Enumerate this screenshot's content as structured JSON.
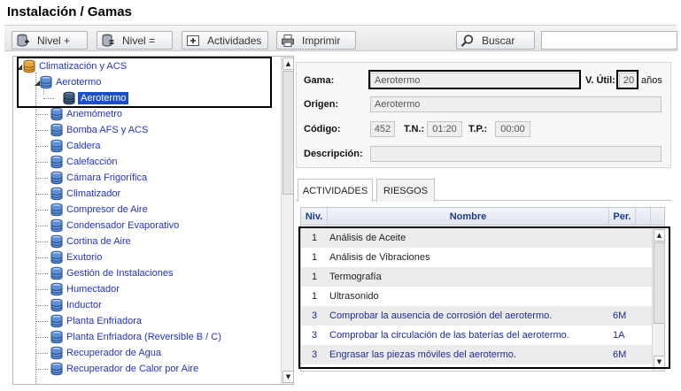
{
  "page": {
    "title": "Instalación / Gamas"
  },
  "toolbar": {
    "nivel_mas": "Nivel +",
    "nivel_igual": "Nivel =",
    "actividades": "Actividades",
    "imprimir": "Imprimir",
    "buscar": "Buscar",
    "search_value": ""
  },
  "tree": {
    "root": "Climatización y ACS",
    "child": "Aerotermo",
    "grandchild": "Aerotermo",
    "items": [
      "Anemómetro",
      "Bomba AFS y ACS",
      "Caldera",
      "Calefacción",
      "Cámara Frigorífica",
      "Climatizador",
      "Compresor de Aire",
      "Condensador Evaporativo",
      "Cortina de Aire",
      "Exutorio",
      "Gestión de Instalaciones",
      "Humectador",
      "Inductor",
      "Planta Enfriadora",
      "Planta Enfriadora (Reversible B / C)",
      "Recuperador de Agua",
      "Recuperador de Calor por Aire"
    ]
  },
  "form": {
    "gama_label": "Gama:",
    "gama_value": "Aerotermo",
    "vutil_label": "V. Útil:",
    "vutil_value": "20",
    "vutil_unit": "años",
    "origen_label": "Origen:",
    "origen_value": "Aerotermo",
    "codigo_label": "Código:",
    "codigo_value": "452",
    "tn_label": "T.N.:",
    "tn_value": "01:20",
    "tp_label": "T.P.:",
    "tp_value": "00:00",
    "descripcion_label": "Descripción:",
    "descripcion_value": ""
  },
  "tabs": {
    "actividades": "ACTIVIDADES",
    "riesgos": "RIESGOS"
  },
  "grid": {
    "headers": {
      "niv": "Niv.",
      "nombre": "Nombre",
      "per": "Per."
    },
    "rows": [
      {
        "niv": "1",
        "nombre": "Análisis de Aceite",
        "per": ""
      },
      {
        "niv": "1",
        "nombre": "Análisis de Vibraciones",
        "per": ""
      },
      {
        "niv": "1",
        "nombre": "Termografía",
        "per": ""
      },
      {
        "niv": "1",
        "nombre": "Ultrasonido",
        "per": ""
      },
      {
        "niv": "3",
        "nombre": "Comprobar la ausencia de corrosión del aerotermo.",
        "per": "6M"
      },
      {
        "niv": "3",
        "nombre": "Comprobar la circulación de las baterías del aerotermo.",
        "per": "1A"
      },
      {
        "niv": "3",
        "nombre": "Engrasar las piezas móviles del aerotermo.",
        "per": "6M"
      }
    ]
  },
  "colors": {
    "link_blue": "#2233cc",
    "header_blue": "#1e3c8c",
    "row_alt": "#ececec"
  },
  "icons": {
    "tree_node": "database-icon",
    "root_node": "database-orange-icon",
    "search": "magnifier-icon",
    "print": "printer-icon"
  }
}
